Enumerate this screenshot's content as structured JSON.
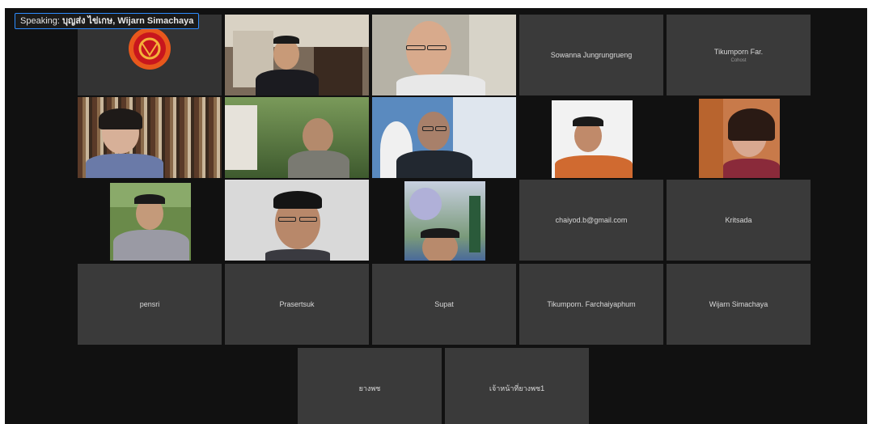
{
  "speaking_bar": {
    "prefix": "Speaking:",
    "names": "บุญส่ง ไข่เกษ, Wijarn Simachaya"
  },
  "participants": {
    "p_sowanna": "Sowanna Jungrungrueng",
    "p_tikumporn_far": "Tikumporn Far.",
    "p_tikumporn_far_role": "Cohost",
    "p_chaiyod": "chaiyod.b@gmail.com",
    "p_kritsada": "Kritsada",
    "p_pensri": "pensri",
    "p_prasertsuk": "Prasertsuk",
    "p_supat": "Supat",
    "p_tikumporn_full": "Tikumporn. Farchaiyaphum",
    "p_wijarn": "Wijarn Simachaya",
    "p_thai1": "ยางพช",
    "p_thai2": "เจ้าหน้าที่ยางพช1"
  },
  "colors": {
    "speaking_border": "#2d8cff",
    "logo_orange": "#e8581c",
    "logo_red": "#c8161d",
    "tile_bg": "#3a3a3a",
    "screen_bg": "#111111"
  }
}
